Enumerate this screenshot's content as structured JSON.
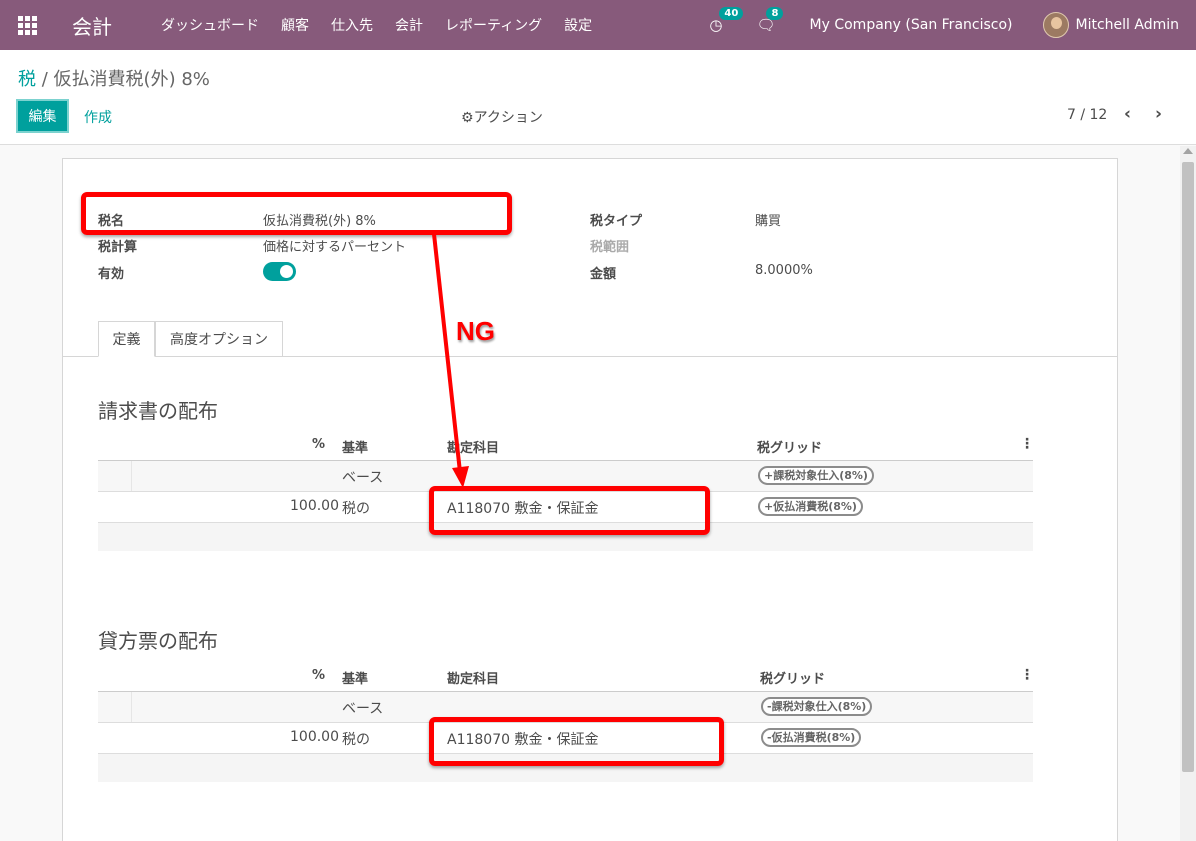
{
  "navbar": {
    "brand": "会計",
    "menu": [
      "ダッシュボード",
      "顧客",
      "仕入先",
      "会計",
      "レポーティング",
      "設定"
    ],
    "activity_count": "40",
    "message_count": "8",
    "company": "My Company (San Francisco)",
    "user": "Mitchell Admin"
  },
  "control_panel": {
    "breadcrumb_parent": "税",
    "breadcrumb_separator": "/",
    "breadcrumb_current": "仮払消費税(外) 8%",
    "edit_label": "編集",
    "create_label": "作成",
    "action_label": "アクション",
    "pager": "7 / 12",
    "prev_glyph": "‹",
    "next_glyph": "›"
  },
  "form": {
    "tax_name_label": "税名",
    "tax_name_value": "仮払消費税(外) 8%",
    "tax_computation_label": "税計算",
    "tax_computation_value": "価格に対するパーセント",
    "active_label": "有効",
    "active": true,
    "tax_type_label": "税タイプ",
    "tax_type_value": "購買",
    "tax_scope_label": "税範囲",
    "amount_label": "金額",
    "amount_value": "8.0000%"
  },
  "tabs": [
    {
      "label": "定義",
      "active": true
    },
    {
      "label": "高度オプション",
      "active": false
    }
  ],
  "invoice_section": {
    "title": "請求書の配布",
    "headers": {
      "percent": "%",
      "base": "基準",
      "account": "勘定科目",
      "grid": "税グリッド"
    },
    "rows": [
      {
        "percent": "",
        "base": "ベース",
        "account": "",
        "tag": "+課税対象仕入(8%)"
      },
      {
        "percent": "100.00",
        "base": "税の",
        "account": "A118070 敷金・保証金",
        "tag": "+仮払消費税(8%)"
      }
    ]
  },
  "refund_section": {
    "title": "貸方票の配布",
    "headers": {
      "percent": "%",
      "base": "基準",
      "account": "勘定科目",
      "grid": "税グリッド"
    },
    "rows": [
      {
        "percent": "",
        "base": "ベース",
        "account": "",
        "tag": "-課税対象仕入(8%)"
      },
      {
        "percent": "100.00",
        "base": "税の",
        "account": "A118070 敷金・保証金",
        "tag": "-仮払消費税(8%)"
      }
    ]
  },
  "annotation": {
    "label": "NG",
    "color": "#ff0000"
  },
  "colors": {
    "navbar": "#875a7b",
    "accent": "#00a09d"
  }
}
